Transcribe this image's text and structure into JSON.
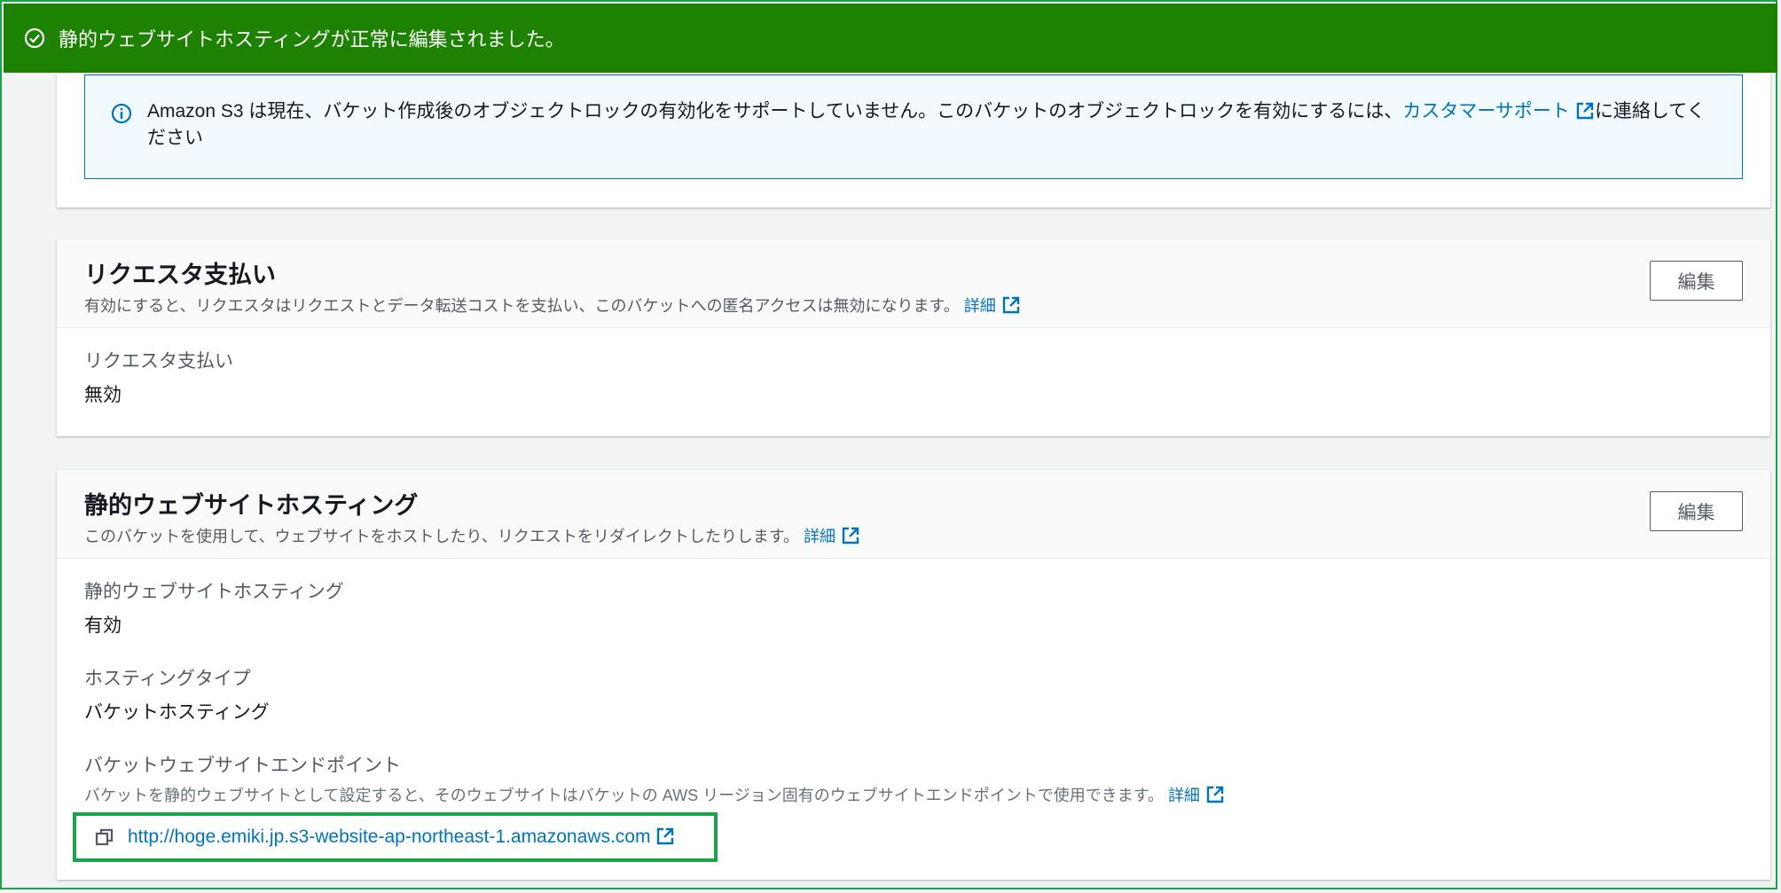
{
  "flash": {
    "message": "静的ウェブサイトホスティングが正常に編集されました。",
    "icon": "check-circle-icon"
  },
  "object_lock_notice": {
    "text_before": "Amazon S3 は現在、バケット作成後のオブジェクトロックの有効化をサポートしていません。このバケットのオブジェクトロックを有効にするには、",
    "link_label": "カスタマーサポート",
    "text_after": "に連絡してください",
    "icon": "info-icon"
  },
  "requester_pays": {
    "title": "リクエスタ支払い",
    "description": "有効にすると、リクエスタはリクエストとデータ転送コストを支払い、このバケットへの匿名アクセスは無効になります。",
    "details_link": "詳細",
    "edit_label": "編集",
    "field_label": "リクエスタ支払い",
    "field_value": "無効"
  },
  "static_hosting": {
    "title": "静的ウェブサイトホスティング",
    "description": "このバケットを使用して、ウェブサイトをホストしたり、リクエストをリダイレクトしたりします。",
    "details_link": "詳細",
    "edit_label": "編集",
    "status_label": "静的ウェブサイトホスティング",
    "status_value": "有効",
    "type_label": "ホスティングタイプ",
    "type_value": "バケットホスティング",
    "endpoint_label": "バケットウェブサイトエンドポイント",
    "endpoint_desc": "バケットを静的ウェブサイトとして設定すると、そのウェブサイトはバケットの AWS リージョン固有のウェブサイトエンドポイントで使用できます。",
    "endpoint_details_link": "詳細",
    "endpoint_url": "http://hoge.emiki.jp.s3-website-ap-northeast-1.amazonaws.com"
  },
  "colors": {
    "success_green": "#1d8102",
    "link_blue": "#0073bb",
    "highlight_green": "#1aa34a"
  }
}
